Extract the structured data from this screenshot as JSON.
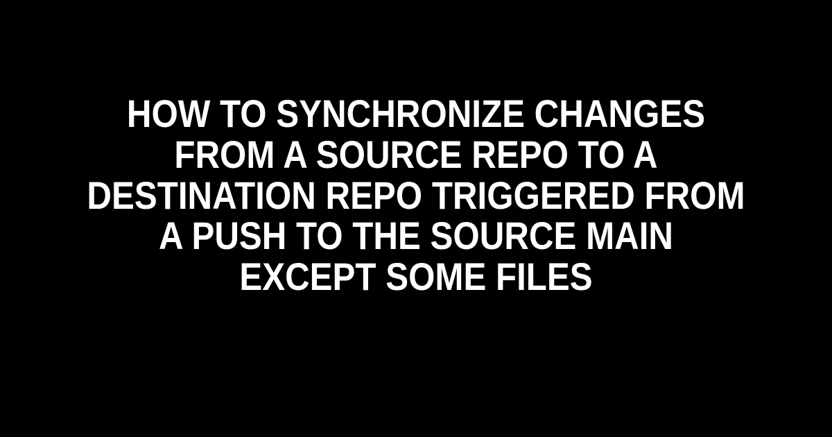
{
  "title": "HOW TO SYNCHRONIZE CHANGES FROM A SOURCE REPO TO A DESTINATION REPO TRIGGERED FROM A PUSH TO THE SOURCE MAIN EXCEPT SOME FILES"
}
